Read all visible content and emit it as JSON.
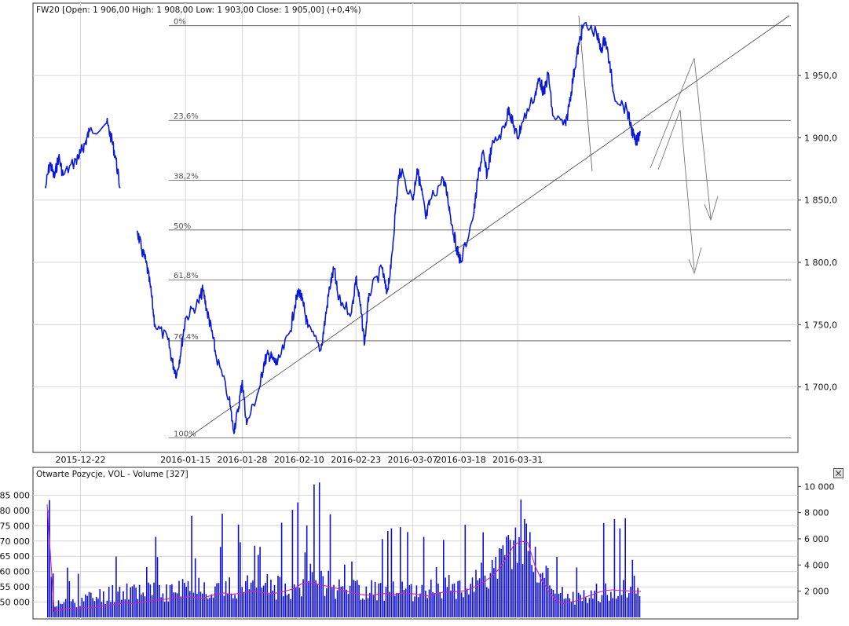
{
  "colors": {
    "price_line": "#0b18d8",
    "volume_bars": "#1010d0",
    "open_interest_line": "#d020c0",
    "grid": "#d6d6d6",
    "level_lines": "#555555",
    "frame": "#333333"
  },
  "icons": {
    "close": "close-icon"
  },
  "chart_data": [
    {
      "type": "line",
      "title": "FW20 [Open: 1 906,00  High: 1 908,00  Low: 1 903,00  Close: 1 905,00] (+0,4%)",
      "x_tick_labels": [
        "2015-12-22",
        "2016-01-15",
        "2016-01-28",
        "2016-02-10",
        "2016-02-23",
        "2016-03-07",
        "2016-03-18",
        "2016-03-31"
      ],
      "y_tick_labels": [
        "1 700,0",
        "1 750,0",
        "1 800,0",
        "1 850,0",
        "1 900,0",
        "1 950,0"
      ],
      "y_ticks": [
        1700,
        1750,
        1800,
        1850,
        1900,
        1950
      ],
      "ylim": [
        1655,
        1998
      ],
      "grid": true,
      "fibonacci_levels": [
        {
          "label": "0%",
          "value": 1990
        },
        {
          "label": "23,6%",
          "value": 1914
        },
        {
          "label": "38,2%",
          "value": 1866
        },
        {
          "label": "50%",
          "value": 1826
        },
        {
          "label": "61,8%",
          "value": 1786
        },
        {
          "label": "76,4%",
          "value": 1737
        },
        {
          "label": "100%",
          "value": 1659
        }
      ],
      "series": [
        {
          "points": [
            [
              "2015-12-14",
              1860
            ],
            [
              "2015-12-15",
              1880
            ],
            [
              "2015-12-16",
              1868
            ],
            [
              "2015-12-17",
              1885
            ],
            [
              "2015-12-18",
              1870
            ],
            [
              "2015-12-21",
              1882
            ],
            [
              "2015-12-22",
              1888
            ],
            [
              "2015-12-23",
              1895
            ],
            [
              "2015-12-24",
              1905
            ],
            [
              "2015-12-28",
              1912
            ],
            [
              "2015-12-29",
              1900
            ],
            [
              "2015-12-30",
              1885
            ],
            [
              "2015-12-31",
              1860
            ],
            [
              "2016-01-04",
              1825
            ],
            [
              "2016-01-05",
              1810
            ],
            [
              "2016-01-06",
              1800
            ],
            [
              "2016-01-07",
              1780
            ],
            [
              "2016-01-08",
              1750
            ],
            [
              "2016-01-11",
              1738
            ],
            [
              "2016-01-12",
              1720
            ],
            [
              "2016-01-13",
              1710
            ],
            [
              "2016-01-14",
              1730
            ],
            [
              "2016-01-15",
              1755
            ],
            [
              "2016-01-18",
              1768
            ],
            [
              "2016-01-19",
              1778
            ],
            [
              "2016-01-20",
              1760
            ],
            [
              "2016-01-21",
              1745
            ],
            [
              "2016-01-22",
              1725
            ],
            [
              "2016-01-25",
              1690
            ],
            [
              "2016-01-26",
              1665
            ],
            [
              "2016-01-27",
              1680
            ],
            [
              "2016-01-28",
              1705
            ],
            [
              "2016-01-29",
              1670
            ],
            [
              "2016-02-01",
              1700
            ],
            [
              "2016-02-02",
              1720
            ],
            [
              "2016-02-03",
              1726
            ],
            [
              "2016-02-04",
              1722
            ],
            [
              "2016-02-05",
              1718
            ],
            [
              "2016-02-08",
              1745
            ],
            [
              "2016-02-09",
              1765
            ],
            [
              "2016-02-10",
              1778
            ],
            [
              "2016-02-11",
              1765
            ],
            [
              "2016-02-12",
              1748
            ],
            [
              "2016-02-15",
              1730
            ],
            [
              "2016-02-16",
              1755
            ],
            [
              "2016-02-17",
              1780
            ],
            [
              "2016-02-18",
              1795
            ],
            [
              "2016-02-19",
              1770
            ],
            [
              "2016-02-22",
              1760
            ],
            [
              "2016-02-23",
              1788
            ],
            [
              "2016-02-24",
              1765
            ],
            [
              "2016-02-25",
              1735
            ],
            [
              "2016-02-26",
              1775
            ],
            [
              "2016-02-29",
              1795
            ],
            [
              "2016-03-01",
              1775
            ],
            [
              "2016-03-02",
              1795
            ],
            [
              "2016-03-03",
              1840
            ],
            [
              "2016-03-04",
              1875
            ],
            [
              "2016-03-07",
              1850
            ],
            [
              "2016-03-08",
              1875
            ],
            [
              "2016-03-09",
              1858
            ],
            [
              "2016-03-10",
              1835
            ],
            [
              "2016-03-11",
              1850
            ],
            [
              "2016-03-14",
              1867
            ],
            [
              "2016-03-15",
              1852
            ],
            [
              "2016-03-16",
              1830
            ],
            [
              "2016-03-17",
              1812
            ],
            [
              "2016-03-18",
              1800
            ],
            [
              "2016-03-21",
              1840
            ],
            [
              "2016-03-22",
              1870
            ],
            [
              "2016-03-23",
              1888
            ],
            [
              "2016-03-24",
              1870
            ],
            [
              "2016-03-25",
              1892
            ],
            [
              "2016-03-28",
              1908
            ],
            [
              "2016-03-29",
              1924
            ],
            [
              "2016-03-30",
              1910
            ],
            [
              "2016-03-31",
              1900
            ],
            [
              "2016-04-01",
              1912
            ],
            [
              "2016-04-04",
              1935
            ],
            [
              "2016-04-05",
              1948
            ],
            [
              "2016-04-06",
              1935
            ],
            [
              "2016-04-07",
              1952
            ],
            [
              "2016-04-08",
              1918
            ],
            [
              "2016-04-11",
              1910
            ],
            [
              "2016-04-12",
              1932
            ],
            [
              "2016-04-13",
              1955
            ],
            [
              "2016-04-14",
              1975
            ],
            [
              "2016-04-15",
              1990
            ],
            [
              "2016-04-18",
              1985
            ],
            [
              "2016-04-19",
              1970
            ],
            [
              "2016-04-20",
              1980
            ],
            [
              "2016-04-21",
              1960
            ],
            [
              "2016-04-22",
              1935
            ],
            [
              "2016-04-25",
              1922
            ],
            [
              "2016-04-26",
              1908
            ],
            [
              "2016-04-27",
              1895
            ],
            [
              "2016-04-28",
              1905
            ]
          ]
        }
      ]
    },
    {
      "type": "bar",
      "title": "Otwarte Pozycje, VOL - Volume [327]",
      "left_axis_tick_labels": [
        "50 000",
        "55 000",
        "60 000",
        "65 000",
        "70 000",
        "75 000",
        "80 000",
        "85 000"
      ],
      "left_axis_ticks": [
        50000,
        55000,
        60000,
        65000,
        70000,
        75000,
        80000,
        85000
      ],
      "left_ylim": [
        45000,
        90000
      ],
      "right_axis_tick_labels": [
        "2 000",
        "4 000",
        "6 000",
        "8 000",
        "10 000"
      ],
      "right_axis_ticks": [
        2000,
        4000,
        6000,
        8000,
        10000
      ],
      "right_ylim": [
        0,
        10500
      ],
      "grid": true,
      "series": [
        {
          "type": "area",
          "axis": "right",
          "values": [
            8200,
            900,
            1000,
            1100,
            1200,
            1300,
            1400,
            1500,
            1600,
            1800,
            1900,
            2000,
            2000,
            2100,
            1900,
            1800,
            1700,
            1800,
            2000,
            2100,
            2200,
            2300,
            2400,
            2200,
            2100,
            2000,
            2100,
            2200,
            2200,
            2300,
            2400,
            2300,
            2200,
            2100,
            2200,
            2400,
            2600,
            2800,
            3000,
            2800,
            2500,
            2300,
            2200,
            2100,
            2000,
            2000,
            2100,
            2000,
            1900,
            1900,
            1800,
            1900,
            2000,
            2000,
            2000,
            2100,
            2100,
            2200,
            2300,
            2400,
            2600,
            2800,
            3000,
            3200,
            3500,
            4500,
            5200,
            6500,
            6000,
            4000,
            3200,
            2800,
            2200,
            1700,
            1500,
            1400,
            1500,
            1600,
            1800,
            1900,
            2000,
            2100,
            2200,
            2200,
            2100
          ]
        },
        {
          "type": "line",
          "axis": "left",
          "values": [
            82000,
            47000,
            47500,
            48000,
            47600,
            48200,
            48000,
            48400,
            48700,
            49000,
            49400,
            49800,
            49500,
            49800,
            50200,
            50500,
            50800,
            51000,
            51400,
            51200,
            51800,
            51500,
            51300,
            52000,
            52500,
            53000,
            52500,
            52800,
            53200,
            53500,
            53200,
            53000,
            52800,
            53200,
            53800,
            54500,
            56000,
            56500,
            56000,
            55500,
            55000,
            54500,
            53800,
            53200,
            52600,
            52300,
            52200,
            52700,
            52800,
            52400,
            53000,
            52800,
            52700,
            52200,
            52000,
            52800,
            53200,
            53300,
            53500,
            53700,
            54500,
            55500,
            57000,
            58500,
            61000,
            64500,
            68500,
            70000,
            69500,
            62000,
            57000,
            53500,
            50500,
            49500,
            50000,
            50500,
            51500,
            52300,
            53200,
            53800,
            54000,
            53800,
            53700,
            53600,
            53500
          ]
        }
      ]
    }
  ]
}
